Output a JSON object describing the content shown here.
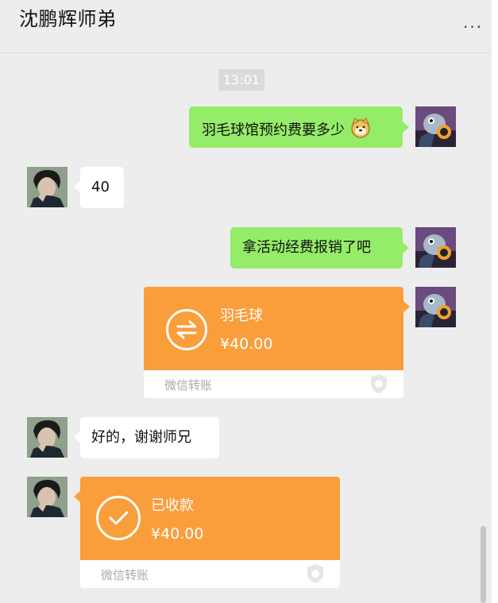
{
  "header": {
    "title": "沈鹏辉师弟",
    "more_icon": "more-icon",
    "more_label": "···"
  },
  "timestamp": "13:01",
  "messages": [
    {
      "side": "right",
      "text": "羽毛球馆预约费要多少",
      "emoji": "doge-emoji"
    },
    {
      "side": "left",
      "text": "40"
    },
    {
      "side": "right",
      "text": "拿活动经费报销了吧"
    },
    {
      "side": "right",
      "type": "transfer",
      "title": "羽毛球",
      "amount": "¥40.00",
      "footer": "微信转账"
    },
    {
      "side": "left",
      "text": "好的，谢谢师兄"
    },
    {
      "side": "left",
      "type": "transfer",
      "title": "已收款",
      "amount": "¥40.00",
      "footer": "微信转账"
    }
  ],
  "colors": {
    "bubble_self": "#95ec69",
    "bubble_other": "#ffffff",
    "transfer": "#fa9d3b",
    "background": "#ededed"
  }
}
